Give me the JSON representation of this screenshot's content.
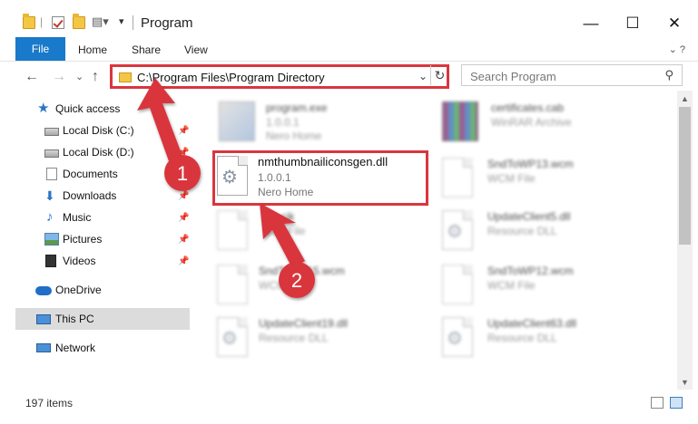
{
  "window": {
    "title": "Program",
    "minimize": "—",
    "maximize": "☐",
    "close": "✕"
  },
  "ribbon": {
    "tabs": [
      "File",
      "Home",
      "Share",
      "View"
    ],
    "expand": "⌄  ?"
  },
  "address": {
    "back": "←",
    "forward": "→",
    "recent": "⌄",
    "up": "↑",
    "path": "C:\\Program Files\\Program Directory",
    "dropdown": "⌄",
    "refresh": "↻"
  },
  "search": {
    "placeholder": "Search Program",
    "icon": "⚲"
  },
  "sidebar": {
    "items": [
      {
        "label": "Quick access",
        "icon": "star-icon",
        "pinned": false
      },
      {
        "label": "Local Disk (C:)",
        "icon": "drive-icon",
        "pinned": true
      },
      {
        "label": "Local Disk (D:)",
        "icon": "drive-icon",
        "pinned": true
      },
      {
        "label": "Documents",
        "icon": "documents-icon",
        "pinned": true
      },
      {
        "label": "Downloads",
        "icon": "download-icon",
        "pinned": true
      },
      {
        "label": "Music",
        "icon": "music-icon",
        "pinned": true
      },
      {
        "label": "Pictures",
        "icon": "pictures-icon",
        "pinned": true
      },
      {
        "label": "Videos",
        "icon": "videos-icon",
        "pinned": true
      },
      {
        "label": "OneDrive",
        "icon": "cloud-icon",
        "pinned": false
      },
      {
        "label": "This PC",
        "icon": "computer-icon",
        "pinned": false,
        "selected": true
      },
      {
        "label": "Network",
        "icon": "network-icon",
        "pinned": false
      }
    ],
    "pin_glyph": "📌"
  },
  "files": [
    {
      "name": "program.exe",
      "line2": "1.0.0.1",
      "line3": "Nero Home",
      "icon": "exe-icon",
      "blurred": true
    },
    {
      "name": "certificates.cab",
      "line2": "WinRAR Archive",
      "line3": "",
      "icon": "archive-icon",
      "blurred": true
    },
    {
      "name": "nmthumbnailiconsgen.dll",
      "line2": "1.0.0.1",
      "line3": "Nero Home",
      "icon": "dll-gear-icon",
      "blurred": false
    },
    {
      "name": "SndToWP13.wcm",
      "line2": "WCM File",
      "line3": "",
      "icon": "document-icon",
      "blurred": true
    },
    {
      "name": "file.cjk",
      "line2": "CJK File",
      "line3": "",
      "icon": "document-icon",
      "blurred": true
    },
    {
      "name": "UpdateClient5.dll",
      "line2": "Resource DLL",
      "line3": "",
      "icon": "dll-gear-icon",
      "blurred": true
    },
    {
      "name": "SndToWP15.wcm",
      "line2": "WCM File",
      "line3": "",
      "icon": "document-icon",
      "blurred": true
    },
    {
      "name": "SndToWP12.wcm",
      "line2": "WCM File",
      "line3": "",
      "icon": "document-icon",
      "blurred": true
    },
    {
      "name": "UpdateClient19.dll",
      "line2": "Resource DLL",
      "line3": "",
      "icon": "dll-gear-icon",
      "blurred": true
    },
    {
      "name": "UpdateClient63.dll",
      "line2": "Resource DLL",
      "line3": "",
      "icon": "dll-gear-icon",
      "blurred": true
    }
  ],
  "status": {
    "items_count": "197 items"
  },
  "annotations": {
    "step1": "1",
    "step2": "2",
    "color": "#d9363e"
  },
  "colors": {
    "accent": "#1979ca",
    "highlight": "#d9363e",
    "selected": "#dcdcdc"
  }
}
